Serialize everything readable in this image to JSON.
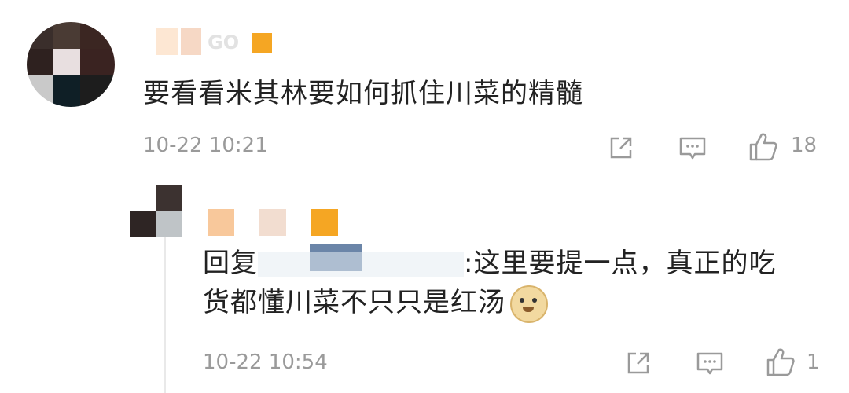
{
  "comment": {
    "text": "要看看米其林要如何抓住川菜的精髓",
    "timestamp": "10-22 10:21",
    "likes": "18",
    "name_tail": "GO"
  },
  "reply": {
    "prefix": "回复",
    "text_line1": ":这里要提一点，真正的吃",
    "text_line2": "货都懂川菜不只只是红汤",
    "timestamp": "10-22 10:54",
    "likes": "1"
  },
  "icons": {
    "share": "share-icon",
    "comment": "comment-icon",
    "like": "thumbs-up-icon",
    "emoji": "doge-emoji-icon"
  }
}
